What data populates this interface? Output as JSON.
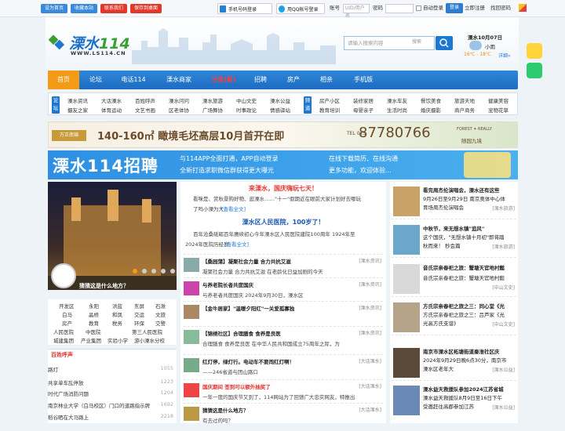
{
  "topbar": {
    "buttons": [
      "设为首页",
      "收藏本站",
      "联系我们",
      "保存到桌面"
    ],
    "btn_colors": [
      "#3b8ad9",
      "#3b8ad9",
      "#e0392b",
      "#e0392b"
    ],
    "phone_login": "手机号码登录",
    "qq_login": "用QQ帐号登录",
    "account_label": "账号",
    "account_placeholder": "UID/用户名",
    "password_label": "密码",
    "auto_login": "自动登录",
    "login": "登录",
    "register": "立即注册",
    "forgot": "找回密码"
  },
  "header": {
    "logo_cn": "溧水",
    "logo_num": "114",
    "logo_url": "WWW.LS114.CN",
    "search_placeholder": "请输入搜索内容",
    "search_select": "搜索",
    "weather": {
      "date": "溧水10月07日",
      "cond": "小雨",
      "temp": "16℃ - 18℃",
      "detail": "详细»"
    }
  },
  "nav": [
    "首页",
    "论坛",
    "电话114",
    "溧水商家",
    "分类(新)",
    "招聘",
    "房产",
    "相亲",
    "手机版"
  ],
  "subnav": {
    "tag1": "论坛",
    "group1": [
      [
        "溧水资讯",
        "大话溧水",
        "百姓呼声",
        "溧水问问",
        "溧水旅游",
        "中山文史",
        "溧水公益",
        "版主区"
      ],
      [
        "摄友之家",
        "体育运动",
        "文艺书画",
        "区老体协",
        "广场舞协",
        "时事政论",
        "情感驿站",
        "站务中心"
      ]
    ],
    "tag2": "频道",
    "group2": [
      [
        "房产小区",
        "装修家居",
        "溧水车友",
        "餐饮美食",
        "旅游天地",
        "健康美容"
      ],
      [
        "教育培训",
        "母婴亲子",
        "生活时尚",
        "婚庆摄影",
        "商户商务",
        "宠物花草"
      ]
    ]
  },
  "ads": {
    "ad1_text": "140-160㎡ 瞰境毛坯高层10月首开在即",
    "ad1_logo": "万正南锦",
    "ad1_phone": "87780766",
    "ad1_tel": "TEL 025",
    "ad1_brand": "FOREST ✦ REALLY",
    "ad1_brand_cn": "随园九境",
    "ad2_title": "溧水114招聘",
    "ad2_items": [
      "与114APP全面打通，APP自动登录",
      "全新打造求职微信群获得更大曝光",
      "在线下载简历、在线沟通",
      "更多功能，欢迎体验..."
    ]
  },
  "slider": {
    "caption": "猜猜这是什么地方？"
  },
  "quick_links": [
    [
      "开发区",
      "永阳",
      "洪蓝",
      "东屏",
      "石湫"
    ],
    [
      "白马",
      "晶桥",
      "和凤",
      "交运",
      "文旅"
    ],
    [
      "房产",
      "教育",
      "税务",
      "环保",
      "交警"
    ],
    [
      "人民医院",
      "中医院",
      "第三人民医院"
    ],
    [
      "城建集团",
      "产业集团",
      "实验小学",
      "游小溧水分校"
    ]
  ],
  "hot": {
    "title": "百姓呼声",
    "items": [
      [
        "路灯",
        "1055"
      ],
      [
        "共享单车乱停放",
        "1223"
      ],
      [
        "时代广场消防问题",
        "1204"
      ],
      [
        "南京林业大学（白马校区）门口的道路指示牌",
        "1692"
      ],
      [
        "稻谷晒在大马路上",
        "2218"
      ]
    ]
  },
  "center": {
    "head1": "来溧水，国庆嗨玩七天！",
    "text1a": "看咪是、赏秋景购好物、逛溧水……\"十一\"假期近在眼前大家计划好去哪玩",
    "text1b": "了吗小溧为大",
    "more1": "[查看全文]",
    "head2": "溧水区人民医院，100岁了！",
    "text2a": "百年沧桑砥砺百年赓续初心今年溧水区人民医院建院100周年 1924年至",
    "text2b": "2024年医院历经岁",
    "more2": "[查看全文]",
    "news": [
      {
        "t": "【桑园蒲】凝聚社会力量 合力共抗艾滋",
        "tag": "[溧水资讯]",
        "d": "凝聚社会力量 合力共抗艾滋 在老龄化日益加剧的今天",
        "red": false
      },
      {
        "t": "与养老院长者共度国庆",
        "tag": "[溧水资讯]",
        "d": "与养老者共度国庆 2024年9月30日，溧水区",
        "red": false
      },
      {
        "t": "【金牛居家】\"温暖夕阳红\"一关爱孤寡独",
        "tag": "[溧水资讯]",
        "d": "",
        "red": false
      },
      {
        "t": "【锦绣社区】合理膳食 食养是良医",
        "tag": "[溧水资讯]",
        "d": "合理膳食 食养是良医 在中华人民共和国成立75周年之际，为",
        "red": false
      },
      {
        "t": "红灯停，绿灯行。电动车不要闯红灯啊！",
        "tag": "[大话溧水]",
        "d": "——246省道与团山路口",
        "red": false
      },
      {
        "t": "国庆期间 签到可以额外抽奖了",
        "tag": "[大话溧水]",
        "d": "一年一度的国庆节又到了，114网站为了回馈广大忠实网友，特推出",
        "red": true
      },
      {
        "t": "猜猜这是什么地方？",
        "tag": "[大话溧水]",
        "d": "有去过的吗？",
        "red": false
      }
    ]
  },
  "right": [
    {
      "t1": "看完周杰伦演唱会，溧水还有这些",
      "t2": "9月26日至9月29日 南京奥体中心体",
      "t3": "育场周杰伦演唱会",
      "tag": "[溧水旅游]",
      "c": "#c9a26a"
    },
    {
      "t1": "中秋节，来无想水镇\"追风\"",
      "t2": "这个国庆，\"无想水镇十月初\"即将踏",
      "t3": "秋而来！ 秒会篇",
      "tag": "[溧水旅游]",
      "c": "#6aa7c9"
    },
    {
      "t1": "音氏宗亲春祀之旅：蟹塘天官地村懿",
      "t2": "音氏宗亲春祀之旅：蟹塘天官地村懿",
      "t3": "",
      "tag": "[中山文史]",
      "c": "#d9d9d9"
    },
    {
      "t1": "方氏宗亲春祀之旅之三：同心堂《光",
      "t2": "方氏宗亲春祀之旅之三：吕芦家《光",
      "t3": "光高方氏支谱》",
      "tag": "[中山文史]",
      "c": "#b5a48a"
    },
    {
      "t1": "南京市溧水区柘塘街道秦淮社区庆",
      "t2": "2024年9月29日晚6点30分，南京市",
      "t3": "溧水区老年大",
      "tag": "[溧水公益]",
      "c": "#5a4a3a"
    },
    {
      "t1": "溧水益天救援队参加2024江苏省城",
      "t2": "溧水益天救援队8月9日至16日下午",
      "t3": "受邀赶往高郡参加江苏",
      "tag": "[溧水公益]",
      "c": "#6a8ab5"
    }
  ],
  "colors": {
    "nav_blue": "#1e78d2",
    "accent_orange": "#f39a16",
    "red": "#e3342f"
  }
}
